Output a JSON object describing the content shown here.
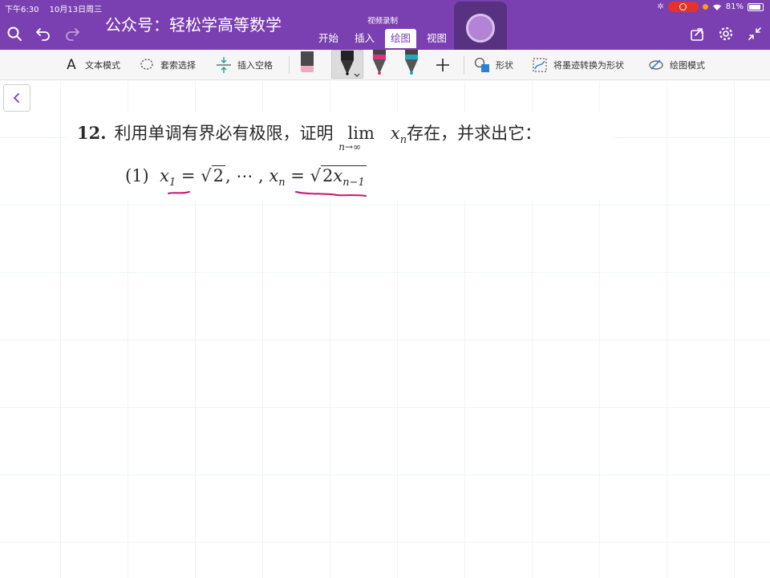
{
  "status": {
    "time": "下午6:30",
    "date": "10月13日周三",
    "battery": "81%"
  },
  "app": {
    "title": "公众号：轻松学高等数学",
    "recording_label": "视频录制"
  },
  "tabs": [
    {
      "label": "开始",
      "active": false
    },
    {
      "label": "插入",
      "active": false
    },
    {
      "label": "绘图",
      "active": true
    },
    {
      "label": "视图",
      "active": false
    }
  ],
  "ribbon": {
    "text_mode": "文本模式",
    "lasso": "套索选择",
    "insert_space": "插入空格",
    "shapes": "形状",
    "ink_to_shape": "将墨迹转换为形状",
    "draw_mode": "绘图模式"
  },
  "colors": {
    "accent": "#7a3fb0",
    "pen_black": "#1a1a1a",
    "pen_pink": "#e0307c",
    "pen_teal": "#22a6c8",
    "ink_annotation": "#c4176b",
    "record": "#e5322b"
  },
  "icons": {
    "search": "search-icon",
    "undo": "undo-icon",
    "redo": "redo-icon",
    "share": "share-icon",
    "settings": "gear-icon",
    "collapse": "collapse-icon",
    "back": "chevron-left-icon"
  },
  "problem": {
    "number": "12.",
    "text_before": "利用单调有界必有极限，证明",
    "lim_word": "lim",
    "lim_sub": "n→∞",
    "x_var": "x",
    "n_sub": "n",
    "text_after": "存在，并求出它：",
    "part_label": "(1)",
    "x1_sub": "1",
    "eq": "=",
    "root_arg": "2",
    "dots": ", ⋯ ,",
    "two": "2",
    "nm1_sub": "n−1"
  }
}
